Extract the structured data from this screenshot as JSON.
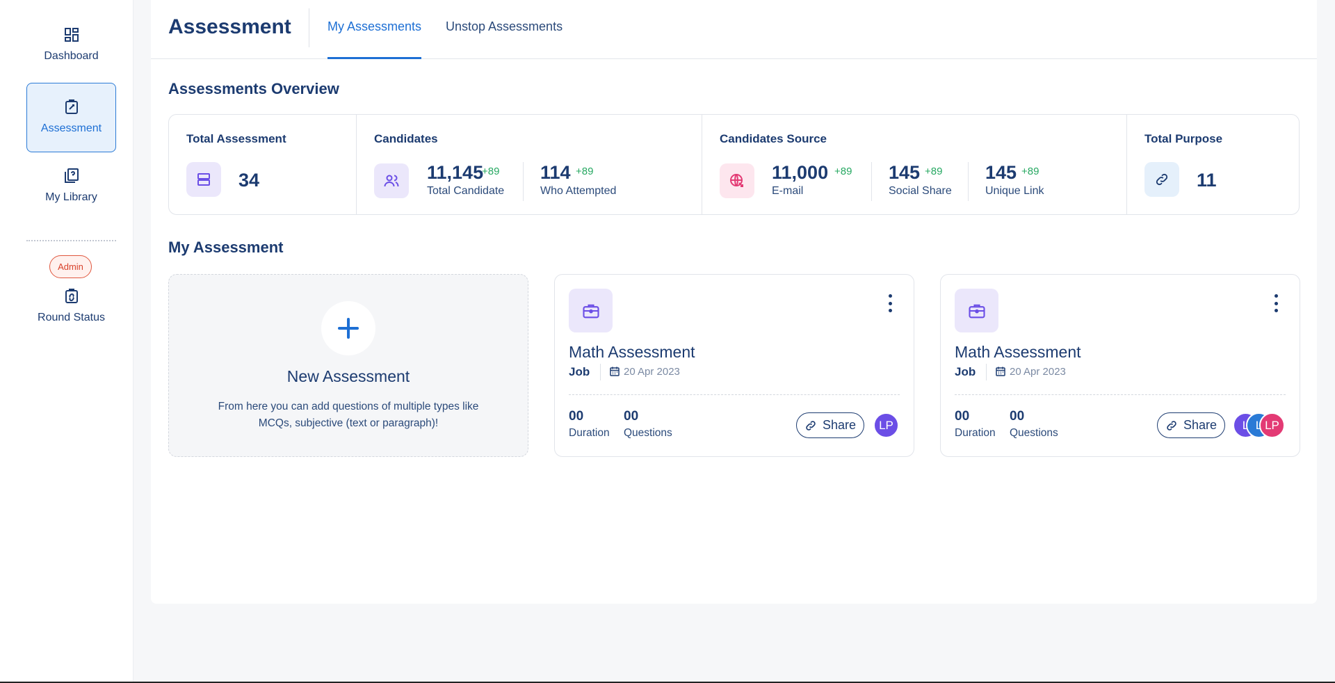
{
  "sidebar": {
    "items": [
      {
        "label": "Dashboard",
        "icon": "dashboard-icon"
      },
      {
        "label": "Assessment",
        "icon": "assessment-icon",
        "active": true
      },
      {
        "label": "My Library",
        "icon": "library-icon"
      },
      {
        "label": "Round Status",
        "icon": "round-status-icon"
      }
    ],
    "admin_badge": "Admin"
  },
  "header": {
    "title": "Assessment",
    "tabs": [
      {
        "label": "My Assessments",
        "active": true
      },
      {
        "label": "Unstop Assessments",
        "active": false
      }
    ]
  },
  "overview": {
    "title": "Assessments Overview",
    "total_assessment": {
      "label": "Total Assessment",
      "value": "34"
    },
    "candidates": {
      "label": "Candidates",
      "total": {
        "value": "11,145",
        "delta": "+89",
        "label": "Total Candidate"
      },
      "attempted": {
        "value": "114",
        "delta": "+89",
        "label": "Who Attempted"
      }
    },
    "source": {
      "label": "Candidates Source",
      "email": {
        "value": "11,000",
        "delta": "+89",
        "label": "E-mail"
      },
      "social": {
        "value": "145",
        "delta": "+89",
        "label": "Social Share"
      },
      "unique": {
        "value": "145",
        "delta": "+89",
        "label": "Unique Link"
      }
    },
    "total_purpose": {
      "label": "Total Purpose",
      "value": "11"
    }
  },
  "my_assessment": {
    "title": "My Assessment",
    "new_card": {
      "title": "New Assessment",
      "description": "From here you can add questions of multiple types like MCQs, subjective (text or paragraph)!"
    },
    "cards": [
      {
        "title": "Math Assessment",
        "type": "Job",
        "date": "20 Apr 2023",
        "duration": {
          "value": "00",
          "label": "Duration"
        },
        "questions": {
          "value": "00",
          "label": "Questions"
        },
        "share_label": "Share",
        "avatars": [
          "LP"
        ]
      },
      {
        "title": "Math Assessment",
        "type": "Job",
        "date": "20 Apr 2023",
        "duration": {
          "value": "00",
          "label": "Duration"
        },
        "questions": {
          "value": "00",
          "label": "Questions"
        },
        "share_label": "Share",
        "avatars": [
          "L",
          "L",
          "LP"
        ]
      }
    ]
  },
  "colors": {
    "accent": "#1d6fd4",
    "navy": "#1c3b70",
    "positive": "#27a862",
    "purple": "#6b4ee6",
    "pink": "#e33a74"
  }
}
